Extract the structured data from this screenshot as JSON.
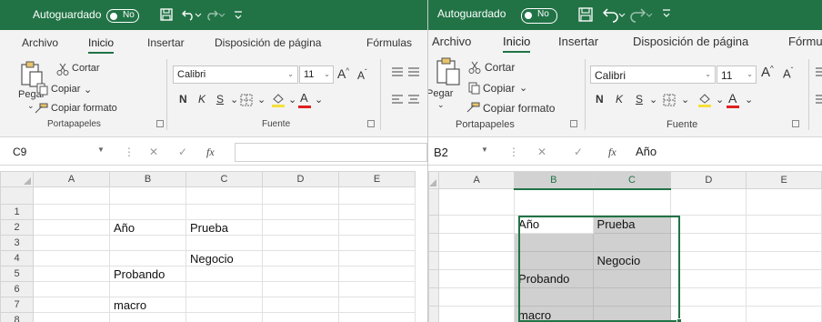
{
  "left": {
    "titlebar": {
      "autosave": "Autoguardado",
      "toggle": "No"
    },
    "tabs": [
      "Archivo",
      "Inicio",
      "Insertar",
      "Disposición de página",
      "Fórmulas"
    ],
    "ribbon": {
      "paste": "Pegar",
      "cut": "Cortar",
      "copy": "Copiar",
      "format_painter": "Copiar formato",
      "font_name": "Calibri",
      "font_size": "11",
      "bold": "N",
      "italic": "K",
      "underline": "S",
      "group_clipboard": "Portapapeles",
      "group_font": "Fuente"
    },
    "formula_bar": {
      "name_box": "C9",
      "fx": "fx",
      "value": ""
    },
    "columns": [
      "A",
      "B",
      "C",
      "D",
      "E"
    ],
    "rows": [
      {
        "num": "",
        "cells": [
          "",
          "",
          "",
          "",
          ""
        ]
      },
      {
        "num": "1",
        "cells": [
          "",
          "",
          "",
          "",
          ""
        ]
      },
      {
        "num": "2",
        "cells": [
          "",
          "Año",
          "Prueba",
          "",
          ""
        ]
      },
      {
        "num": "3",
        "cells": [
          "",
          "",
          "",
          "",
          ""
        ]
      },
      {
        "num": "4",
        "cells": [
          "",
          "",
          "Negocio",
          "",
          ""
        ]
      },
      {
        "num": "5",
        "cells": [
          "",
          "Probando",
          "",
          "",
          ""
        ]
      },
      {
        "num": "6",
        "cells": [
          "",
          "",
          "",
          "",
          ""
        ]
      },
      {
        "num": "7",
        "cells": [
          "",
          "macro",
          "",
          "",
          ""
        ]
      },
      {
        "num": "8",
        "cells": [
          "",
          "",
          "",
          "",
          ""
        ]
      }
    ]
  },
  "right": {
    "titlebar": {
      "autosave": "Autoguardado",
      "toggle": "No"
    },
    "tabs": [
      "Archivo",
      "Inicio",
      "Insertar",
      "Disposición de página",
      "Fórmu"
    ],
    "ribbon": {
      "paste": "Pegar",
      "cut": "Cortar",
      "copy": "Copiar",
      "format_painter": "Copiar formato",
      "font_name": "Calibri",
      "font_size": "11",
      "bold": "N",
      "italic": "K",
      "underline": "S",
      "group_clipboard": "Portapapeles",
      "group_font": "Fuente"
    },
    "formula_bar": {
      "name_box": "B2",
      "fx": "fx",
      "value": "Año"
    },
    "columns": [
      "A",
      "B",
      "C",
      "D",
      "E"
    ],
    "rows": [
      {
        "num": "",
        "cells": [
          "",
          "",
          "",
          "",
          ""
        ]
      },
      {
        "num": "",
        "cells": [
          "",
          "Año",
          "Prueba",
          "",
          ""
        ]
      },
      {
        "num": "",
        "cells": [
          "",
          "",
          "",
          "",
          ""
        ]
      },
      {
        "num": "",
        "cells": [
          "",
          "",
          "Negocio",
          "",
          ""
        ]
      },
      {
        "num": "",
        "cells": [
          "",
          "Probando",
          "",
          "",
          ""
        ]
      },
      {
        "num": "",
        "cells": [
          "",
          "",
          "",
          "",
          ""
        ]
      },
      {
        "num": "",
        "cells": [
          "",
          "macro",
          "",
          "",
          ""
        ]
      }
    ],
    "selection": "B2:C8"
  },
  "colors": {
    "excel_green": "#217346",
    "selection_fill": "#d0d0d0",
    "font_color_underline": "#e02020",
    "highlight": "#f4e03a"
  }
}
